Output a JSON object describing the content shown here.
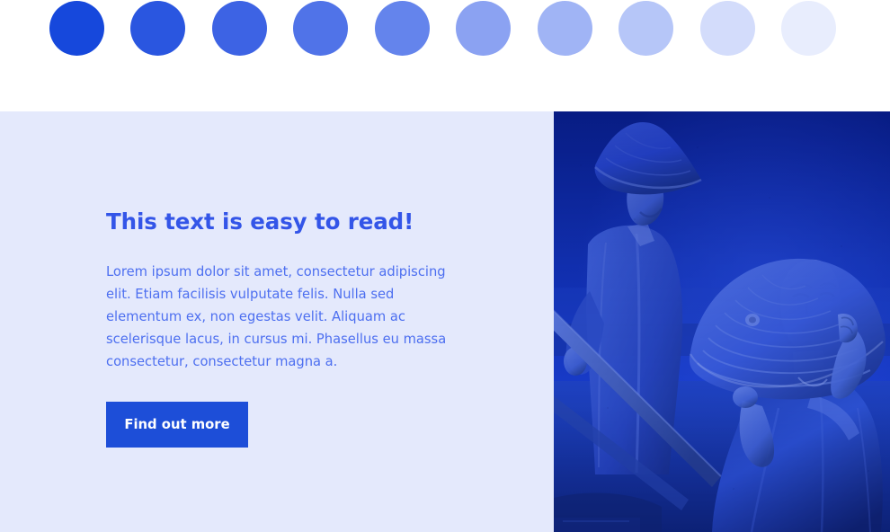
{
  "palette": {
    "accent": "#1d4ed8",
    "heading_color": "#3355e8",
    "body_color": "#4d6ff0",
    "panel_bg": "#e4e9fc",
    "page_bg": "#ffffff",
    "button_bg": "#1d4ed8",
    "button_text": "#ffffff",
    "image_duotone": "#1534b4"
  },
  "swatches": {
    "name": "blue-scale",
    "count": 10,
    "diameter": 61,
    "items": [
      {
        "index": 1,
        "color": "#1648dc"
      },
      {
        "index": 2,
        "color": "#2a56e0"
      },
      {
        "index": 3,
        "color": "#3d63e4"
      },
      {
        "index": 4,
        "color": "#5073e8"
      },
      {
        "index": 5,
        "color": "#6484ec"
      },
      {
        "index": 6,
        "color": "#8ba2f2"
      },
      {
        "index": 7,
        "color": "#a0b4f5"
      },
      {
        "index": 8,
        "color": "#b6c6f8"
      },
      {
        "index": 9,
        "color": "#d3dcfb"
      },
      {
        "index": 10,
        "color": "#e8edfd"
      }
    ]
  },
  "hero": {
    "heading": "This text is easy to read!",
    "paragraph": "Lorem ipsum dolor sit amet, consectetur adipiscing elit. Etiam facilisis vulputate felis. Nulla sed elementum ex, non egestas velit. Aliquam ac scelerisque lacus, in cursus mi. Phasellus eu massa consectetur, consectetur magna a.",
    "cta_label": "Find out more",
    "image": {
      "name": "duotone-photo",
      "alt": "Blue duotone photograph of two women wearing conical straw hats on a boat",
      "tint": "#1534b4"
    }
  }
}
